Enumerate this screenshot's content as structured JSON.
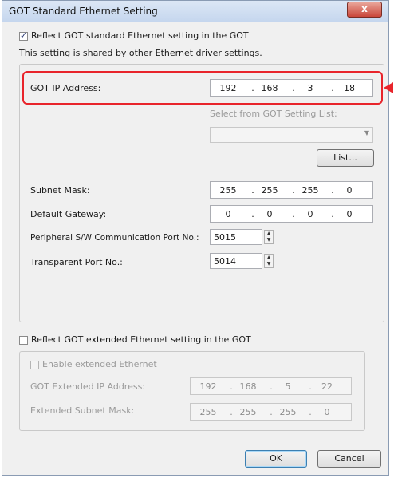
{
  "window": {
    "title": "GOT Standard Ethernet Setting",
    "close_glyph": "x"
  },
  "reflect_std": {
    "label": "Reflect GOT standard Ethernet setting in the GOT",
    "checked": true
  },
  "shared_note": "This setting is shared by other Ethernet driver settings.",
  "got_ip": {
    "label": "GOT IP Address:",
    "octets": [
      "192",
      "168",
      "3",
      "18"
    ]
  },
  "select_list": {
    "label": "Select from GOT Setting List:",
    "value": ""
  },
  "list_button": "List...",
  "subnet": {
    "label": "Subnet Mask:",
    "octets": [
      "255",
      "255",
      "255",
      "0"
    ]
  },
  "gateway": {
    "label": "Default Gateway:",
    "octets": [
      "0",
      "0",
      "0",
      "0"
    ]
  },
  "peripheral_port": {
    "label": "Peripheral S/W Communication Port No.:",
    "value": "5015"
  },
  "transparent_port": {
    "label": "Transparent Port No.:",
    "value": "5014"
  },
  "reflect_ext": {
    "label": "Reflect GOT extended Ethernet setting in the GOT",
    "checked": false
  },
  "enable_ext": {
    "label": "Enable extended Ethernet",
    "checked": false
  },
  "ext_ip": {
    "label": "GOT Extended IP Address:",
    "octets": [
      "192",
      "168",
      "5",
      "22"
    ]
  },
  "ext_subnet": {
    "label": "Extended Subnet Mask:",
    "octets": [
      "255",
      "255",
      "255",
      "0"
    ]
  },
  "ok_button": "OK",
  "cancel_button": "Cancel",
  "colors": {
    "highlight": "#e8242b"
  }
}
